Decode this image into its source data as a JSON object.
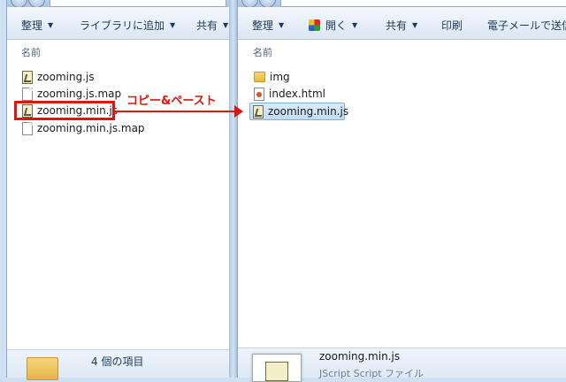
{
  "left_window": {
    "toolbar": {
      "organize": "整理",
      "add_library": "ライブラリに追加",
      "share": "共有"
    },
    "column_header": "名前",
    "files": [
      {
        "name": "zooming.js",
        "icon": "js-script-icon"
      },
      {
        "name": "zooming.js.map",
        "icon": "document-icon"
      },
      {
        "name": "zooming.min.js",
        "icon": "js-script-icon",
        "highlighted": true
      },
      {
        "name": "zooming.min.js.map",
        "icon": "document-icon"
      }
    ],
    "status": {
      "item_count": "4 個の項目"
    }
  },
  "right_window": {
    "toolbar": {
      "organize": "整理",
      "open": "開く",
      "share": "共有",
      "print": "印刷",
      "email": "電子メールで送信"
    },
    "column_header": "名前",
    "files": [
      {
        "name": "img",
        "icon": "folder-icon"
      },
      {
        "name": "index.html",
        "icon": "html-file-icon"
      },
      {
        "name": "zooming.min.js",
        "icon": "js-script-icon",
        "selected": true
      }
    ],
    "status": {
      "selected_name": "zooming.min.js",
      "selected_type": "JScript Script ファイル"
    }
  },
  "annotation": {
    "label": "コピー&ペースト",
    "color": "#e3130f"
  }
}
